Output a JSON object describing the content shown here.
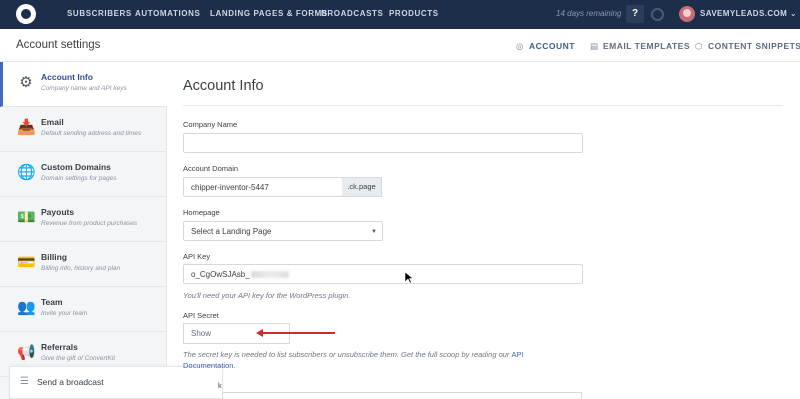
{
  "topnav": {
    "items": [
      "SUBSCRIBERS",
      "AUTOMATIONS",
      "LANDING PAGES & FORMS",
      "BROADCASTS",
      "PRODUCTS"
    ],
    "trial": "14 days remaining",
    "help": "?",
    "account": "SAVEMYLEADS.COM ⌄"
  },
  "subheader": {
    "title": "Account settings",
    "tabs": [
      {
        "label": "ACCOUNT",
        "icon": "user-circle-icon",
        "active": true
      },
      {
        "label": "EMAIL TEMPLATES",
        "icon": "document-icon",
        "active": false
      },
      {
        "label": "CONTENT SNIPPETS",
        "icon": "cube-icon",
        "active": false
      }
    ]
  },
  "sidebar": {
    "items": [
      {
        "label": "Account Info",
        "desc": "Company name and API keys",
        "icon": "gear-icon",
        "active": true
      },
      {
        "label": "Email",
        "desc": "Default sending address and times",
        "icon": "inbox-icon",
        "active": false
      },
      {
        "label": "Custom Domains",
        "desc": "Domain settings for pages",
        "icon": "globe-icon",
        "active": false
      },
      {
        "label": "Payouts",
        "desc": "Revenue from product purchases",
        "icon": "money-icon",
        "active": false
      },
      {
        "label": "Billing",
        "desc": "Billing info, history and plan",
        "icon": "credit-card-icon",
        "active": false
      },
      {
        "label": "Team",
        "desc": "Invite your team",
        "icon": "people-icon",
        "active": false
      },
      {
        "label": "Referrals",
        "desc": "Give the gift of ConvertKit",
        "icon": "megaphone-icon",
        "active": false
      }
    ]
  },
  "broadcast_bar": {
    "label": "Send a broadcast"
  },
  "main": {
    "title": "Account Info",
    "company_name": {
      "label": "Company Name",
      "value": ""
    },
    "account_domain": {
      "label": "Account Domain",
      "value": "chipper-inventor-5447",
      "suffix": ".ck.page"
    },
    "homepage": {
      "label": "Homepage",
      "value": "Select a Landing Page"
    },
    "api_key": {
      "label": "API Key",
      "value": "o_CgOwSJAsb_",
      "help": "You'll need your API key for the WordPress plugin."
    },
    "api_secret": {
      "label": "API Secret",
      "button": "Show",
      "help_line1": "The secret key is needed to list subscribers or unsubscribe them. Get the full scoop by reading our",
      "help_link": "API",
      "help_line2": "Documentation."
    },
    "truncated_label": "k"
  },
  "colors": {
    "nav_bg": "#1d2e4a",
    "accent": "#3f6ac1",
    "annotation_arrow": "#d22a2a"
  }
}
